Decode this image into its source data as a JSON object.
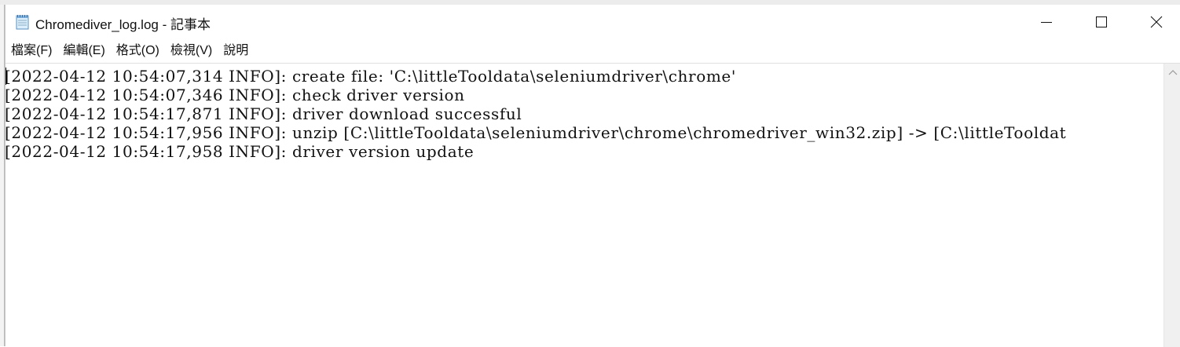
{
  "window": {
    "title": "Chromediver_log.log - 記事本"
  },
  "menu": {
    "items": [
      {
        "label": "檔案(F)"
      },
      {
        "label": "編輯(E)"
      },
      {
        "label": "格式(O)"
      },
      {
        "label": "檢視(V)"
      },
      {
        "label": "說明"
      }
    ]
  },
  "editor": {
    "lines": [
      "[2022-04-12 10:54:07,314 INFO]: create file: 'C:\\littleTooldata\\seleniumdriver\\chrome'",
      "[2022-04-12 10:54:07,346 INFO]: check driver version",
      "[2022-04-12 10:54:17,871 INFO]: driver download successful",
      "[2022-04-12 10:54:17,956 INFO]: unzip [C:\\littleTooldata\\seleniumdriver\\chrome\\chromedriver_win32.zip] -> [C:\\littleTooldat",
      "[2022-04-12 10:54:17,958 INFO]: driver version update"
    ]
  },
  "icons": {
    "app": "notepad-icon",
    "minimize": "minimize-icon",
    "maximize": "maximize-icon",
    "close": "close-icon",
    "scroll_up": "chevron-up-icon"
  },
  "colors": {
    "text": "#111111",
    "scrollbar": "#f0f0f0"
  }
}
